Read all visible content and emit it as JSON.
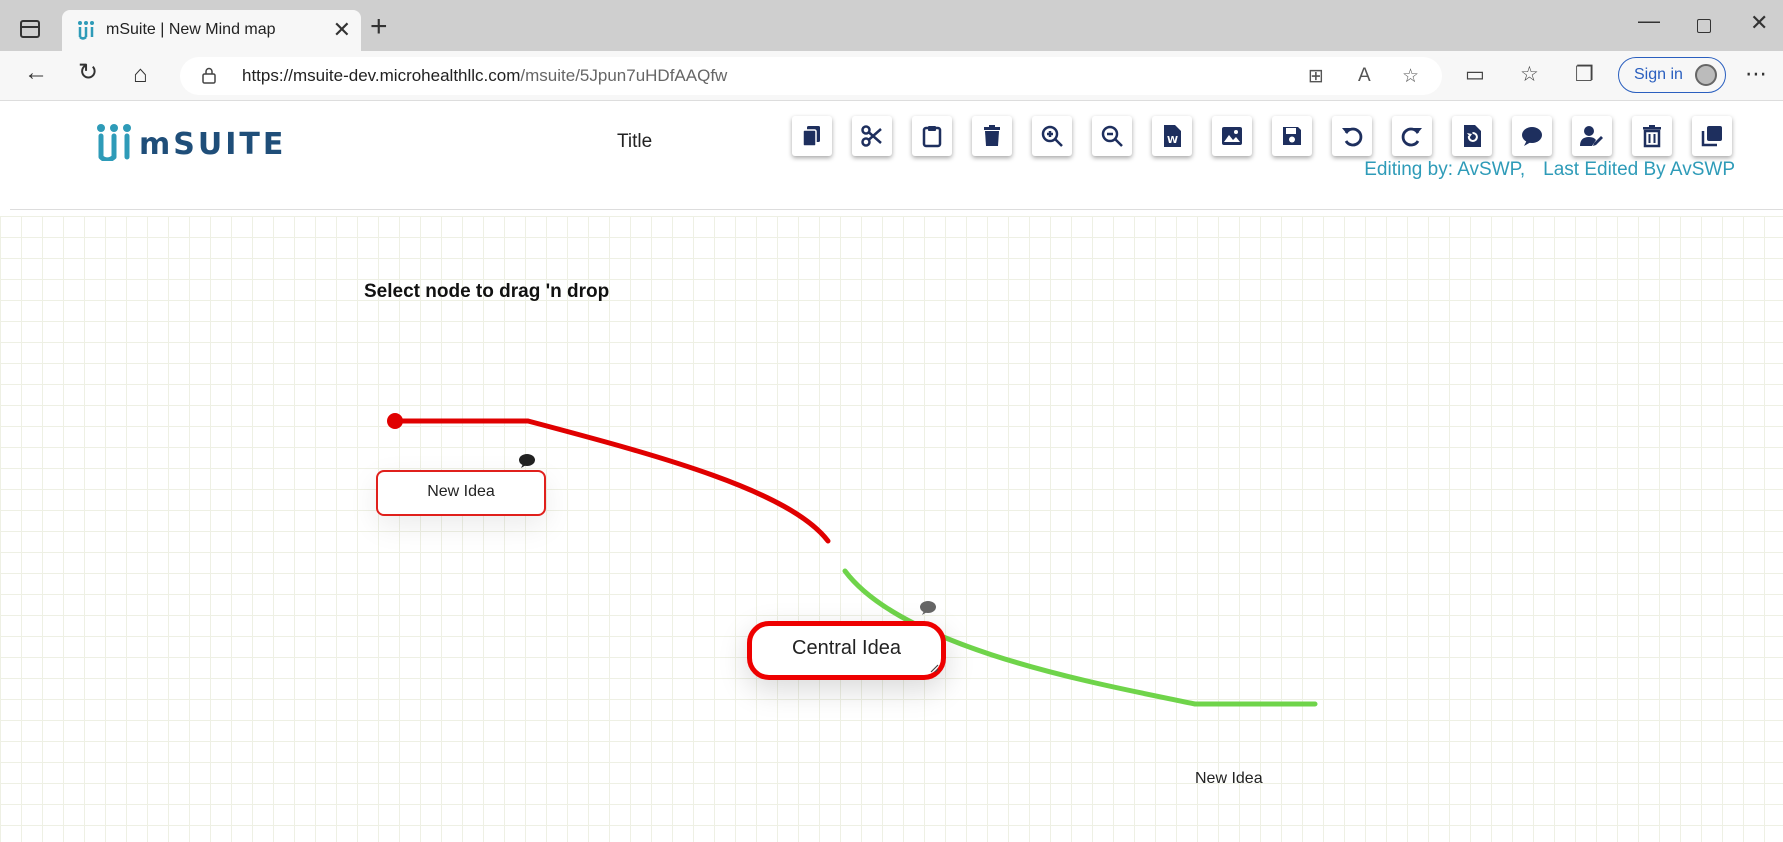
{
  "browser": {
    "tab_title": "mSuite | New Mind map",
    "url_host": "https://msuite-dev.microhealthllc.com",
    "url_path": "/msuite/5Jpun7uHDfAAQfw",
    "sign_in_label": "Sign in",
    "icons": {
      "back": "back-arrow-icon",
      "refresh": "refresh-icon",
      "home": "home-icon",
      "lock": "lock-icon",
      "more": "more-icon"
    }
  },
  "app": {
    "logo_text": "mSUITE",
    "title": "Title",
    "editing_by": "Editing by: AvSWP,",
    "last_edited": "Last Edited By AvSWP",
    "toolbar": [
      "copy",
      "cut",
      "paste",
      "delete",
      "zoom-in",
      "zoom-out",
      "export-word",
      "export-image",
      "save",
      "undo",
      "redo",
      "reset",
      "comment",
      "edit-user",
      "trash",
      "duplicate"
    ]
  },
  "canvas": {
    "hint": "Select node to drag 'n drop",
    "nodes": {
      "left_child": "New Idea",
      "central": "Central Idea",
      "right_child": "New Idea"
    },
    "colors": {
      "left_branch": "#e00000",
      "right_branch": "#6fd44a",
      "accent": "#2e9bb8",
      "icon_navy": "#1e2f5e"
    }
  }
}
